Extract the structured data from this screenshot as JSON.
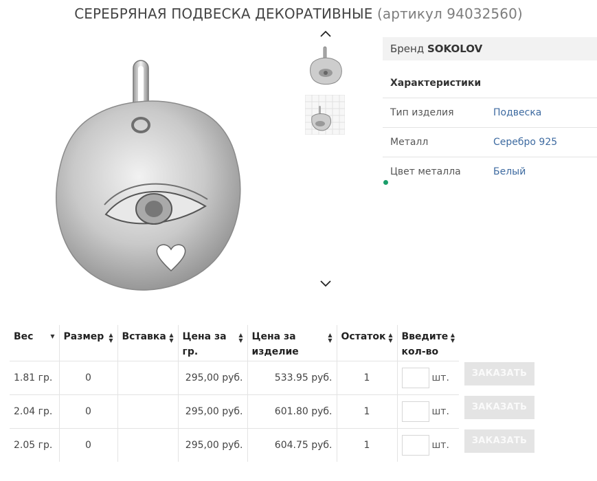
{
  "product": {
    "title": "СЕРЕБРЯНАЯ ПОДВЕСКА ДЕКОРАТИВНЫЕ",
    "article": "(артикул 94032560)"
  },
  "gallery": {
    "up_icon": "chevron-up-icon",
    "down_icon": "chevron-down-icon",
    "thumb_count": 2
  },
  "brand": {
    "label": "Бренд",
    "value": "SOKOLOV"
  },
  "specs": {
    "heading": "Характеристики",
    "rows": [
      {
        "key": "Тип изделия",
        "value": "Подвеска"
      },
      {
        "key": "Металл",
        "value": "Серебро 925"
      },
      {
        "key": "Цвет металла",
        "value": "Белый"
      }
    ]
  },
  "table": {
    "headers": {
      "weight": "Вес",
      "size": "Размер",
      "insert": "Вставка",
      "price_gram_1": "Цена за",
      "price_gram_2": "гр.",
      "price_item_1": "Цена за",
      "price_item_2": "изделие",
      "stock": "Остаток",
      "qty_1": "Введите",
      "qty_2": "кол-во"
    },
    "unit": "шт.",
    "order_label": "ЗАКАЗАТЬ",
    "rows": [
      {
        "weight": "1.81 гр.",
        "size": "0",
        "insert": "",
        "price_gram": "295,00 руб.",
        "price_item": "533.95 руб.",
        "stock": "1",
        "unit": "шт.",
        "order": "ЗАКАЗАТЬ"
      },
      {
        "weight": "2.04 гр.",
        "size": "0",
        "insert": "",
        "price_gram": "295,00 руб.",
        "price_item": "601.80 руб.",
        "stock": "1",
        "unit": "шт.",
        "order": "ЗАКАЗАТЬ"
      },
      {
        "weight": "2.05 гр.",
        "size": "0",
        "insert": "",
        "price_gram": "295,00 руб.",
        "price_item": "604.75 руб.",
        "stock": "1",
        "unit": "шт.",
        "order": "ЗАКАЗАТЬ"
      }
    ]
  },
  "colors": {
    "link": "#3d6aa0",
    "button_bg": "#e4e4e4",
    "online_dot": "#1a9e6a"
  }
}
